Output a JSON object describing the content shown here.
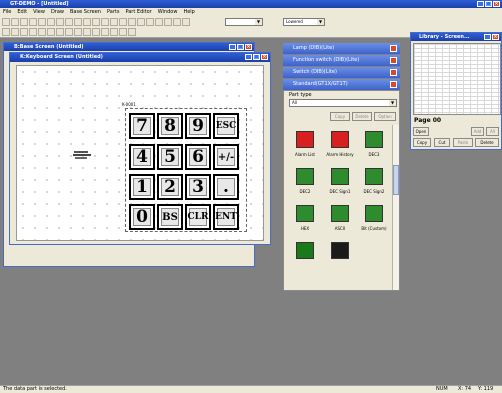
{
  "app": {
    "title": "GT-DEMO - [Untitled]",
    "menu": [
      "File",
      "Edit",
      "View",
      "Draw",
      "Base Screen",
      "Parts",
      "Part Editor",
      "Window",
      "Help"
    ],
    "screen_select": "",
    "zoom": "Lowered"
  },
  "base_window": {
    "title": "B:Base Screen (Untitled)"
  },
  "keypad_window": {
    "title": "K:Keyboard Screen (Untitled)",
    "tag": "K-0001",
    "keys": [
      "7",
      "8",
      "9",
      "ESC",
      "4",
      "5",
      "6",
      "+/-",
      "1",
      "2",
      "3",
      ".",
      "0",
      "BS",
      "CLR",
      "ENT"
    ]
  },
  "palettes": {
    "tabs": [
      "Lamp (DIB)(Lite)",
      "Function switch (DIB)(Lite)",
      "Switch (DIB)(Lite)",
      "Standard(GT1X/GT1T)"
    ],
    "part_type_label": "Part type",
    "part_type_value": "All",
    "copy_btn": "Copy",
    "delete_btn": "Delete",
    "option_btn": "Option",
    "items": [
      {
        "label": "Alarm List",
        "color": "#d82020"
      },
      {
        "label": "Alarm History",
        "color": "#d82020"
      },
      {
        "label": "DEC3",
        "color": "#2e8b2e"
      },
      {
        "label": "DEC2",
        "color": "#2e8b2e"
      },
      {
        "label": "DEC Sign1",
        "color": "#2e8b2e"
      },
      {
        "label": "DEC Sign2",
        "color": "#2e8b2e"
      },
      {
        "label": "HEX",
        "color": "#2e8b2e"
      },
      {
        "label": "ASCII",
        "color": "#2e8b2e"
      },
      {
        "label": "Bit (Custom)",
        "color": "#2e8b2e"
      },
      {
        "label": "",
        "color": "#1a7a1a"
      },
      {
        "label": "",
        "color": "#1a1a1a"
      }
    ]
  },
  "library": {
    "title": "Library - Screen...",
    "page_label": "Page 00",
    "open_btn": "Open",
    "copy_btn": "Copy",
    "cut_btn": "Cut",
    "paste_btn": "Paste",
    "delete_btn": "Delete",
    "add_btn": "Add",
    "all_btn": "All"
  },
  "status": {
    "message": "The data part is selected.",
    "mode": "NUM",
    "x": "X: 74",
    "y": "Y: 119"
  }
}
